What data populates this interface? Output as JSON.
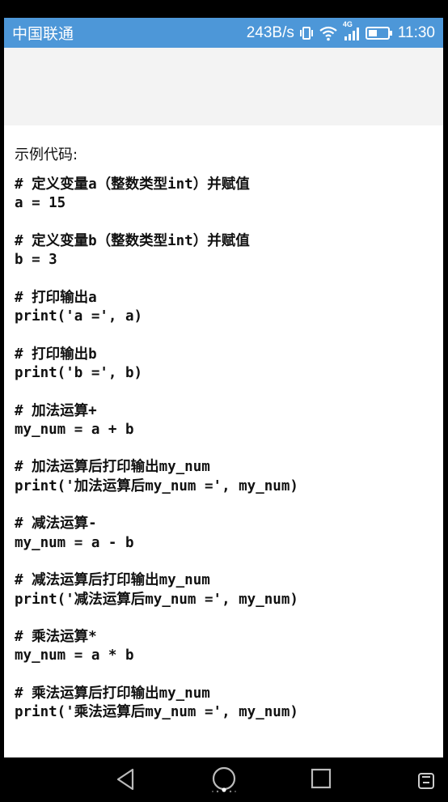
{
  "status_bar": {
    "carrier": "中国联通",
    "net_speed": "243B/s",
    "network_type": "4G",
    "time": "11:30",
    "icons": [
      "vibrate-icon",
      "wifi-icon",
      "signal-icon",
      "battery-icon"
    ]
  },
  "page": {
    "intro": "示例代码:",
    "code_blocks": [
      {
        "comment": "# 定义变量a（整数类型int）并赋值",
        "code": "a = 15"
      },
      {
        "comment": "# 定义变量b（整数类型int）并赋值",
        "code": "b = 3"
      },
      {
        "comment": "# 打印输出a",
        "code": "print('a =', a)"
      },
      {
        "comment": "# 打印输出b",
        "code": "print('b =', b)"
      },
      {
        "comment": "# 加法运算+",
        "code": "my_num = a + b"
      },
      {
        "comment": "# 加法运算后打印输出my_num",
        "code": "print('加法运算后my_num =', my_num)"
      },
      {
        "comment": "# 减法运算-",
        "code": "my_num = a - b"
      },
      {
        "comment": "# 减法运算后打印输出my_num",
        "code": "print('减法运算后my_num =', my_num)"
      },
      {
        "comment": "# 乘法运算*",
        "code": "my_num = a * b"
      },
      {
        "comment": "# 乘法运算后打印输出my_num",
        "code": "print('乘法运算后my_num =', my_num)"
      }
    ]
  },
  "nav_bar": {
    "buttons": [
      "back-icon",
      "home-icon",
      "recents-icon",
      "screenshot-icon"
    ]
  },
  "colors": {
    "status_bar_bg": "#4d97d8",
    "banner_bg": "#f3f3f3",
    "text": "#111111"
  }
}
